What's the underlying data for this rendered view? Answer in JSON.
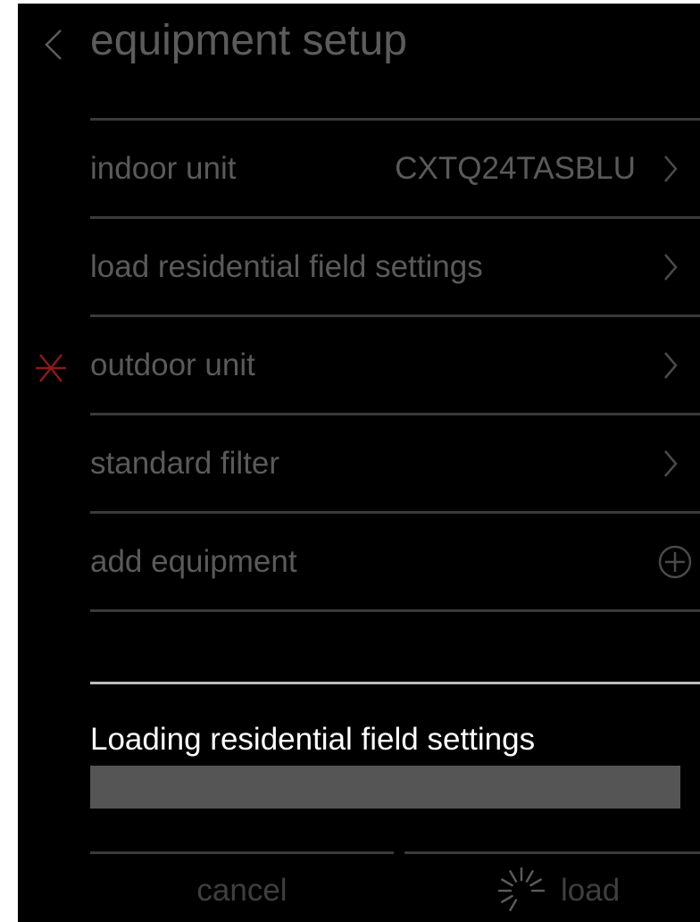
{
  "header": {
    "back_icon": "chevron-left-icon",
    "title": "equipment setup"
  },
  "rows": [
    {
      "label": "indoor unit",
      "value": "CXTQ24TASBLU",
      "trailing_icon": "chevron-right-icon"
    },
    {
      "label": "load residential field settings",
      "value": "",
      "trailing_icon": "chevron-right-icon"
    },
    {
      "label": "outdoor unit",
      "value": "",
      "trailing_icon": "chevron-right-icon",
      "marker_icon": "asterisk-icon",
      "marker_color": "#8b1a1a"
    },
    {
      "label": "standard filter",
      "value": "",
      "trailing_icon": "chevron-right-icon"
    },
    {
      "label": "add equipment",
      "value": "",
      "trailing_icon": "plus-circle-icon"
    }
  ],
  "loading": {
    "message": "Loading residential field settings",
    "progress": 0
  },
  "buttons": {
    "cancel_label": "cancel",
    "load_label": "load",
    "load_icon": "spinner-icon"
  },
  "colors": {
    "background": "#000000",
    "dim_text": "#5a5a5a",
    "active_text": "#ffffff",
    "required_marker": "#8b1a1a",
    "progress_track": "#555555"
  }
}
